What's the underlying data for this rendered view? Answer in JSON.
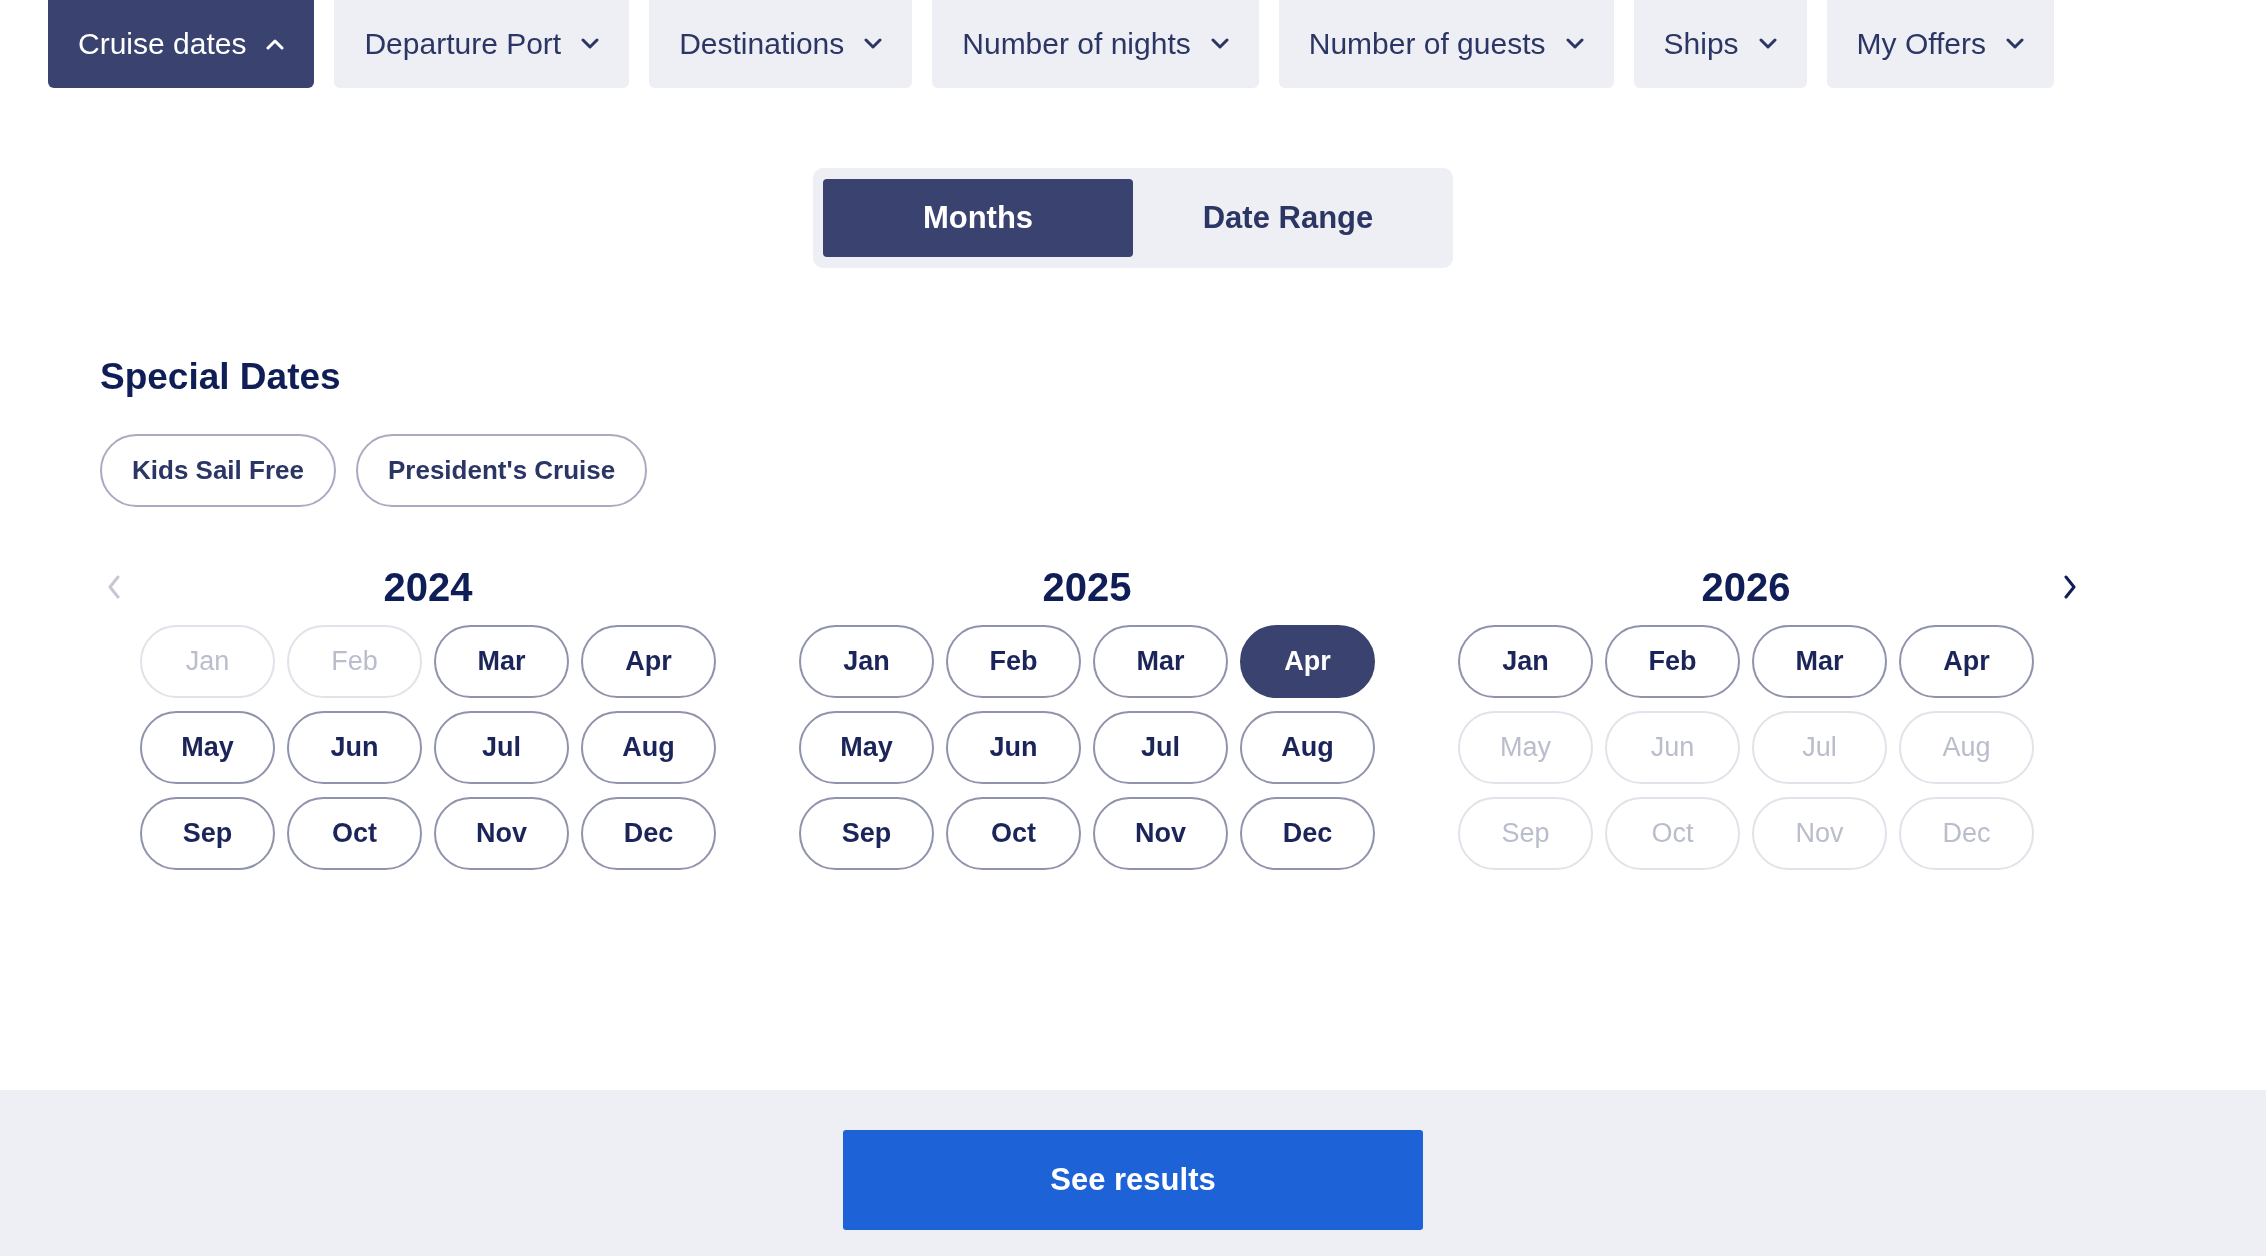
{
  "filters": [
    {
      "label": "Cruise dates",
      "expanded": true
    },
    {
      "label": "Departure Port",
      "expanded": false
    },
    {
      "label": "Destinations",
      "expanded": false
    },
    {
      "label": "Number of nights",
      "expanded": false
    },
    {
      "label": "Number of guests",
      "expanded": false
    },
    {
      "label": "Ships",
      "expanded": false
    },
    {
      "label": "My Offers",
      "expanded": false
    }
  ],
  "mode_tabs": [
    {
      "label": "Months",
      "selected": true
    },
    {
      "label": "Date Range",
      "selected": false
    }
  ],
  "special_dates": {
    "heading": "Special Dates",
    "chips": [
      {
        "label": "Kids Sail Free",
        "selected": false
      },
      {
        "label": "President's Cruise",
        "selected": false
      }
    ]
  },
  "calendar": {
    "prev_disabled": true,
    "next_disabled": false,
    "years": [
      {
        "year": "2024",
        "months": [
          {
            "label": "Jan",
            "disabled": true,
            "selected": false
          },
          {
            "label": "Feb",
            "disabled": true,
            "selected": false
          },
          {
            "label": "Mar",
            "disabled": false,
            "selected": false
          },
          {
            "label": "Apr",
            "disabled": false,
            "selected": false
          },
          {
            "label": "May",
            "disabled": false,
            "selected": false
          },
          {
            "label": "Jun",
            "disabled": false,
            "selected": false
          },
          {
            "label": "Jul",
            "disabled": false,
            "selected": false
          },
          {
            "label": "Aug",
            "disabled": false,
            "selected": false
          },
          {
            "label": "Sep",
            "disabled": false,
            "selected": false
          },
          {
            "label": "Oct",
            "disabled": false,
            "selected": false
          },
          {
            "label": "Nov",
            "disabled": false,
            "selected": false
          },
          {
            "label": "Dec",
            "disabled": false,
            "selected": false
          }
        ]
      },
      {
        "year": "2025",
        "months": [
          {
            "label": "Jan",
            "disabled": false,
            "selected": false
          },
          {
            "label": "Feb",
            "disabled": false,
            "selected": false
          },
          {
            "label": "Mar",
            "disabled": false,
            "selected": false
          },
          {
            "label": "Apr",
            "disabled": false,
            "selected": true
          },
          {
            "label": "May",
            "disabled": false,
            "selected": false
          },
          {
            "label": "Jun",
            "disabled": false,
            "selected": false
          },
          {
            "label": "Jul",
            "disabled": false,
            "selected": false
          },
          {
            "label": "Aug",
            "disabled": false,
            "selected": false
          },
          {
            "label": "Sep",
            "disabled": false,
            "selected": false
          },
          {
            "label": "Oct",
            "disabled": false,
            "selected": false
          },
          {
            "label": "Nov",
            "disabled": false,
            "selected": false
          },
          {
            "label": "Dec",
            "disabled": false,
            "selected": false
          }
        ]
      },
      {
        "year": "2026",
        "months": [
          {
            "label": "Jan",
            "disabled": false,
            "selected": false
          },
          {
            "label": "Feb",
            "disabled": false,
            "selected": false
          },
          {
            "label": "Mar",
            "disabled": false,
            "selected": false
          },
          {
            "label": "Apr",
            "disabled": false,
            "selected": false
          },
          {
            "label": "May",
            "disabled": true,
            "selected": false
          },
          {
            "label": "Jun",
            "disabled": true,
            "selected": false
          },
          {
            "label": "Jul",
            "disabled": true,
            "selected": false
          },
          {
            "label": "Aug",
            "disabled": true,
            "selected": false
          },
          {
            "label": "Sep",
            "disabled": true,
            "selected": false
          },
          {
            "label": "Oct",
            "disabled": true,
            "selected": false
          },
          {
            "label": "Nov",
            "disabled": true,
            "selected": false
          },
          {
            "label": "Dec",
            "disabled": true,
            "selected": false
          }
        ]
      }
    ]
  },
  "footer": {
    "button": "See results"
  }
}
